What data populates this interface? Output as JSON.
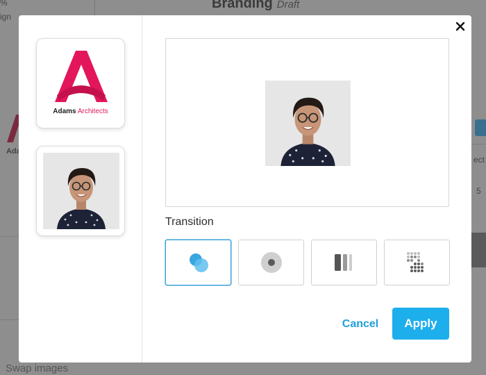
{
  "background": {
    "title": "Branding",
    "status": "Draft",
    "fragments": {
      "top_left_a": "%",
      "top_left_b": "ign",
      "left_mid": "Ada",
      "right_a": "ect",
      "right_b": "5",
      "bottom": "Swap images"
    }
  },
  "modal": {
    "sidebar": {
      "logo_thumb": {
        "brand_name_bold": "Adams",
        "brand_name_rest": " Architects",
        "brand_color": "#e3165b"
      },
      "photo_thumb": {
        "icon": "person-photo"
      }
    },
    "close_icon": "close-icon",
    "transition_label": "Transition",
    "transitions": [
      {
        "name": "blend-icon",
        "selected": true
      },
      {
        "name": "circle-icon",
        "selected": false
      },
      {
        "name": "wipe-bars-icon",
        "selected": false
      },
      {
        "name": "dissolve-dots-icon",
        "selected": false
      }
    ],
    "actions": {
      "cancel_label": "Cancel",
      "apply_label": "Apply"
    },
    "colors": {
      "accent": "#1daeec",
      "selected_border": "#3aa0d8"
    }
  }
}
